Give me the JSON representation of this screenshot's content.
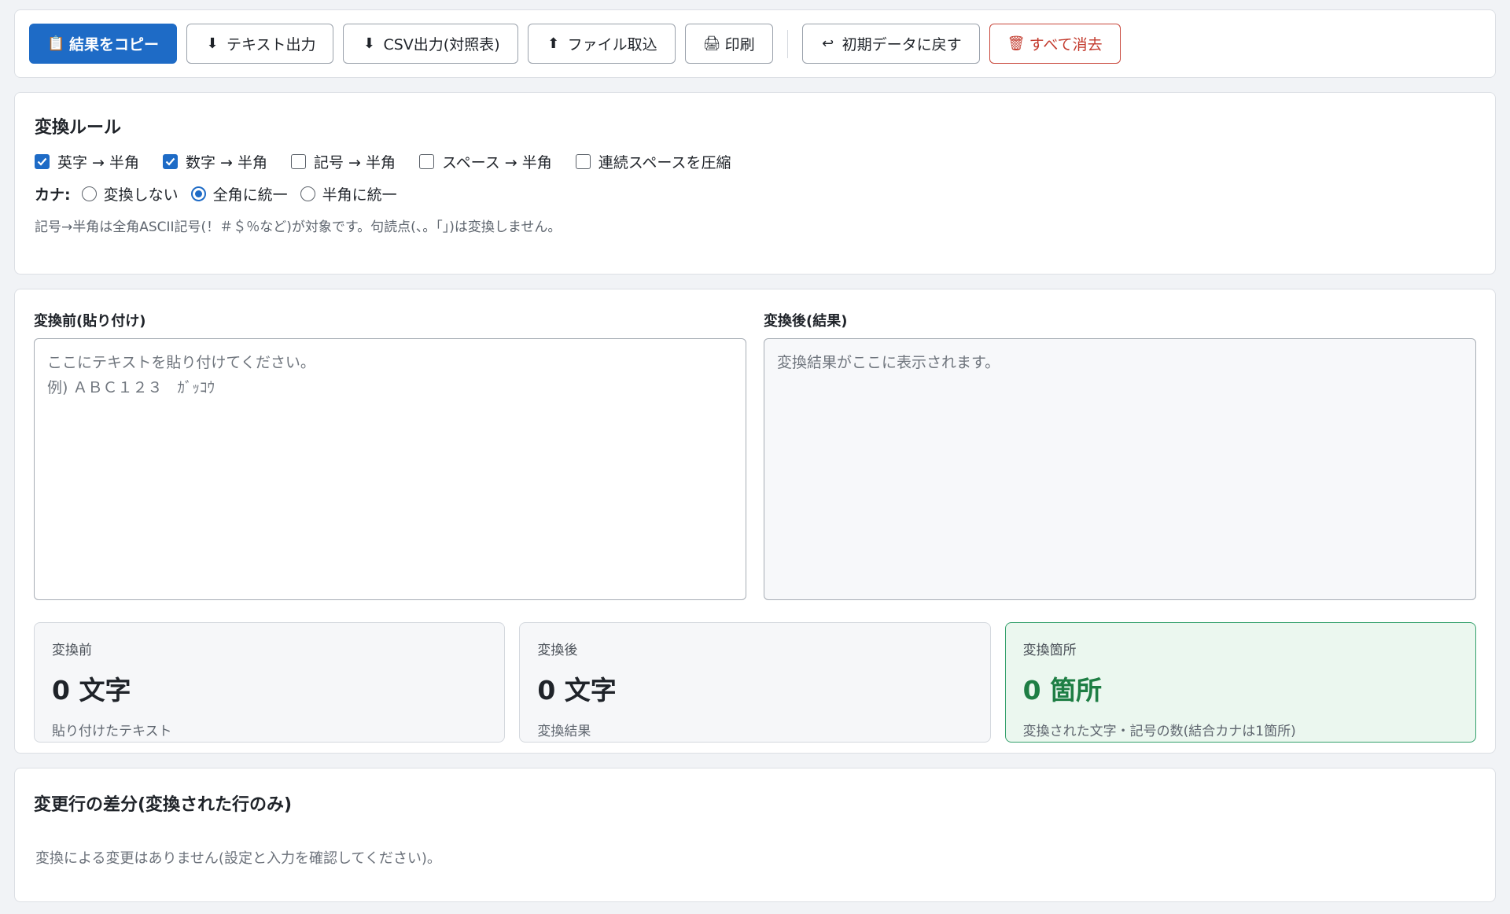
{
  "toolbar": {
    "copy": {
      "icon": "📋",
      "label": "結果をコピー"
    },
    "text_export": {
      "icon": "⬇",
      "label": "テキスト出力"
    },
    "csv_export": {
      "icon": "⬇",
      "label": "CSV出力(対照表)"
    },
    "file_import": {
      "icon": "⬆",
      "label": "ファイル取込"
    },
    "print": {
      "icon": "🖨",
      "label": "印刷"
    },
    "reset": {
      "icon": "↩",
      "label": "初期データに戻す"
    },
    "clear": {
      "icon": "🗑",
      "label": "すべて消去"
    }
  },
  "rules": {
    "title": "変換ルール",
    "options": [
      {
        "label": "英字 → 半角",
        "checked": true
      },
      {
        "label": "数字 → 半角",
        "checked": true
      },
      {
        "label": "記号 → 半角",
        "checked": false
      },
      {
        "label": "スペース → 半角",
        "checked": false
      },
      {
        "label": "連続スペースを圧縮",
        "checked": false
      }
    ],
    "kana_label": "カナ:",
    "kana_options": [
      {
        "label": "変換しない",
        "selected": false
      },
      {
        "label": "全角に統一",
        "selected": true
      },
      {
        "label": "半角に統一",
        "selected": false
      }
    ],
    "note": "記号→半角は全角ASCII記号(！＃＄％など)が対象です。句読点(、。「」)は変換しません。"
  },
  "editor": {
    "input_label": "変換前(貼り付け)",
    "input_placeholder": "ここにテキストを貼り付けてください。\n例) ＡＢＣ１２３　ｶﾞｯｺｳ",
    "output_label": "変換後(結果)",
    "output_placeholder": "変換結果がここに表示されます。"
  },
  "stats": [
    {
      "title": "変換前",
      "value": "0 文字",
      "sub": "貼り付けたテキスト"
    },
    {
      "title": "変換後",
      "value": "0 文字",
      "sub": "変換結果"
    },
    {
      "title": "変換箇所",
      "value": "0 箇所",
      "sub": "変換された文字・記号の数(結合カナは1箇所)"
    }
  ],
  "diff": {
    "title": "変更行の差分(変換された行のみ)",
    "empty": "変換による変更はありません(設定と入力を確認してください)。"
  },
  "colors": {
    "primary": "#1e6bc6",
    "danger": "#c33a2d",
    "success": "#1e7e44"
  }
}
